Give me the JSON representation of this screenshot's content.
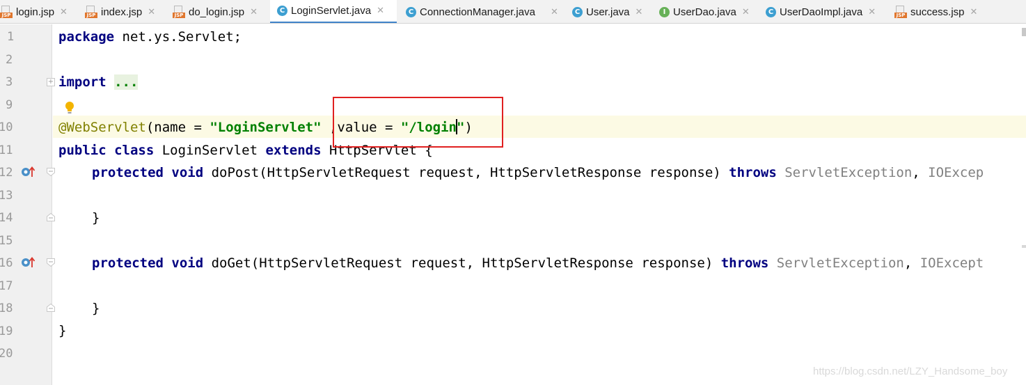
{
  "tabs": [
    {
      "label": "login.jsp",
      "icon": "jsp-file-icon"
    },
    {
      "label": "index.jsp",
      "icon": "jsp-file-icon"
    },
    {
      "label": "do_login.jsp",
      "icon": "jsp-file-icon"
    },
    {
      "label": "LoginServlet.java",
      "icon": "java-class-icon",
      "active": true
    },
    {
      "label": "ConnectionManager.java",
      "icon": "java-class-icon"
    },
    {
      "label": "User.java",
      "icon": "java-class-icon"
    },
    {
      "label": "UserDao.java",
      "icon": "java-interface-icon"
    },
    {
      "label": "UserDaoImpl.java",
      "icon": "java-class-icon"
    },
    {
      "label": "success.jsp",
      "icon": "jsp-file-icon"
    }
  ],
  "icon_letters": {
    "class": "C",
    "interface": "I",
    "jsp": "JSP"
  },
  "close_glyph": "✕",
  "line_numbers": [
    "1",
    "2",
    "3",
    "9",
    "10",
    "11",
    "12",
    "13",
    "14",
    "15",
    "16",
    "17",
    "18",
    "19",
    "20"
  ],
  "code": {
    "l1_kw": "package",
    "l1_rest": " net.ys.Servlet;",
    "l3_kw": "import",
    "l3_fold": "...",
    "l10_ann": "@WebServlet",
    "l10_a": "(name = ",
    "l10_name": "\"LoginServlet\"",
    "l10_b": " ,value = ",
    "l10_val1": "\"/login",
    "l10_val2": "\"",
    "l10_c": ")",
    "l11_kw1": "public",
    "l11_kw2": "class",
    "l11_name": " LoginServlet ",
    "l11_kw3": "extends",
    "l11_rest": " HttpServlet {",
    "l12_kw1": "protected",
    "l12_kw2": "void",
    "l12_mid": " doPost(HttpServletRequest request, HttpServletResponse response) ",
    "l12_kw3": "throws",
    "l12_ex1": " ServletException",
    "l12_sep": ", ",
    "l12_ex2": "IOExcep",
    "l14": "}",
    "l16_kw1": "protected",
    "l16_kw2": "void",
    "l16_mid": " doGet(HttpServletRequest request, HttpServletResponse response) ",
    "l16_kw3": "throws",
    "l16_ex1": " ServletException",
    "l16_sep": ", ",
    "l16_ex2": "IOExcept",
    "l18": "}",
    "l19": "}"
  },
  "watermark": "https://blog.csdn.net/LZY_Handsome_boy",
  "colors": {
    "keyword": "#000080",
    "annotation": "#808000",
    "string": "#008000",
    "highlight": "#e02020",
    "active_tab_underline": "#4083c9"
  }
}
